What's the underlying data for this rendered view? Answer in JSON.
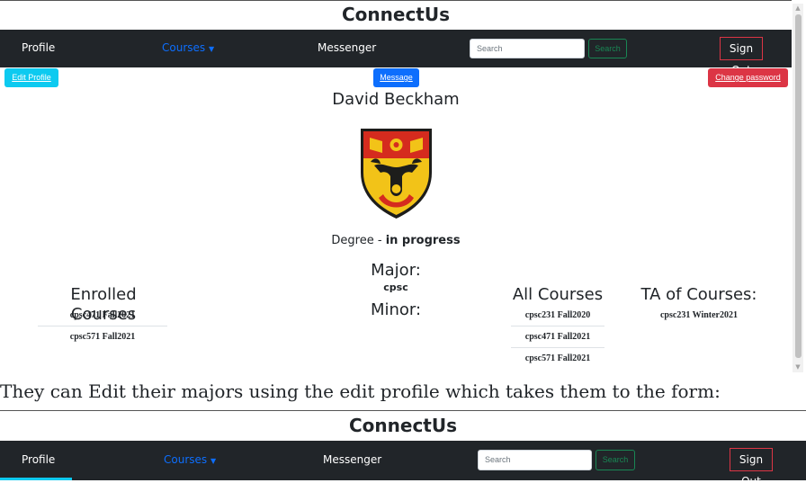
{
  "app": {
    "brand": "ConnectUs"
  },
  "nav": {
    "profile": "Profile",
    "courses": "Courses",
    "messenger": "Messenger",
    "search_placeholder": "Search",
    "search_button": "Search",
    "sign_out": "Sign Out"
  },
  "actions": {
    "edit_profile": "Edit Profile",
    "message": "Message",
    "change_password": "Change password"
  },
  "profile": {
    "name": "David Beckham",
    "degree_label": "Degree - ",
    "degree_status": "in progress",
    "major_label": "Major:",
    "major_value": "cpsc",
    "minor_label": "Minor:"
  },
  "enrolled": {
    "title": "Enrolled Courses",
    "items": [
      "cpsc471 Fall2021",
      "cpsc571 Fall2021"
    ]
  },
  "all_courses": {
    "title": "All Courses",
    "items": [
      "cpsc231 Fall2020",
      "cpsc471 Fall2021",
      "cpsc571 Fall2021"
    ]
  },
  "ta_courses": {
    "title": "TA of Courses:",
    "items": [
      "cpsc231 Winter2021"
    ]
  },
  "caption": "They can Edit their majors using the edit profile which takes them to the form:",
  "colors": {
    "navbar": "#212529",
    "primary": "#0d6efd",
    "info": "#0dcaf0",
    "danger": "#dc3545",
    "success": "#198754"
  }
}
